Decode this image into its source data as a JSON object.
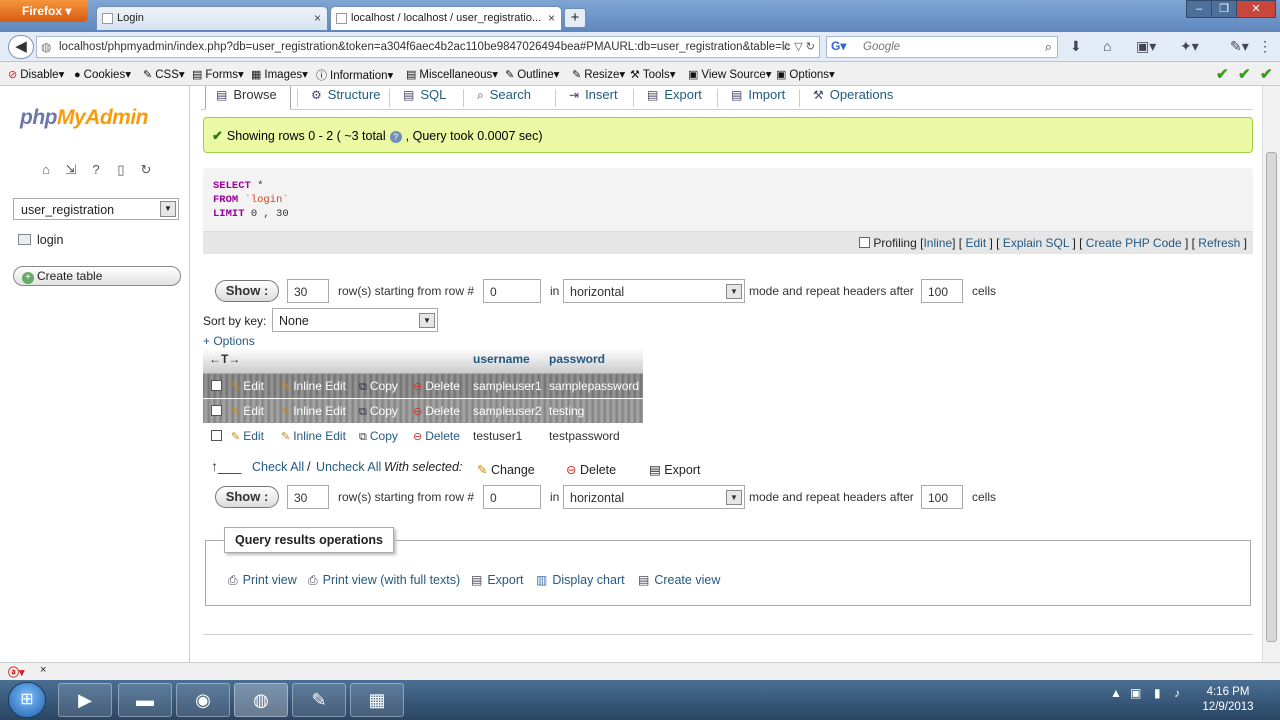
{
  "browser": {
    "firefox_label": "Firefox",
    "tabs": [
      {
        "title": "Login"
      },
      {
        "title": "localhost / localhost / user_registratio..."
      }
    ],
    "url": "localhost/phpmyadmin/index.php?db=user_registration&token=a304f6aec4b2ac110be9847026494bea#PMAURL:db=user_registration&table=lc",
    "search_placeholder": "Google",
    "devbar": [
      "Disable",
      "Cookies",
      "CSS",
      "Forms",
      "Images",
      "Information",
      "Miscellaneous",
      "Outline",
      "Resize",
      "Tools",
      "View Source",
      "Options"
    ]
  },
  "sidebar": {
    "logo_php": "php",
    "logo_myadmin": "MyAdmin",
    "db_selected": "user_registration",
    "tables": [
      "login"
    ],
    "create_table": "Create table"
  },
  "menu": {
    "tabs": [
      "Browse",
      "Structure",
      "SQL",
      "Search",
      "Insert",
      "Export",
      "Import",
      "Operations"
    ],
    "active": "Browse"
  },
  "message": {
    "text": "Showing rows 0 - 2 ( ~3 total",
    "suffix": ", Query took 0.0007 sec)"
  },
  "sql": {
    "line1_kw": "SELECT",
    "line1_rest": " *",
    "line2_kw": "FROM",
    "line2_rest": " `login`",
    "line3_kw": "LIMIT",
    "line3_rest": " 0 , 30",
    "tools": {
      "profiling": "Profiling",
      "inline": "Inline",
      "edit": "Edit",
      "explain": "Explain SQL",
      "create_php": "Create PHP Code",
      "refresh": "Refresh"
    }
  },
  "nav": {
    "show_label": "Show :",
    "rows": "30",
    "rows_text": "row(s) starting from row #",
    "start_row": "0",
    "in_text": "in",
    "mode": "horizontal",
    "mode_text": "mode and repeat headers after",
    "repeat": "100",
    "cells_text": "cells"
  },
  "sort": {
    "label": "Sort by key:",
    "value": "None"
  },
  "options_link": "+ Options",
  "table": {
    "arrows": "←T→",
    "columns": [
      "username",
      "password"
    ],
    "actions": {
      "edit": "Edit",
      "inline_edit": "Inline Edit",
      "copy": "Copy",
      "delete": "Delete"
    },
    "rows": [
      {
        "username": "sampleuser1",
        "password": "samplepassword"
      },
      {
        "username": "sampleuser2",
        "password": "testing"
      },
      {
        "username": "testuser1",
        "password": "testpassword"
      }
    ]
  },
  "with_selected": {
    "check_all": "Check All",
    "sep": " / ",
    "uncheck_all": "Uncheck All",
    "label": "With selected:",
    "change": "Change",
    "delete": "Delete",
    "export": "Export"
  },
  "query_ops": {
    "title": "Query results operations",
    "items": [
      "Print view",
      "Print view (with full texts)",
      "Export",
      "Display chart",
      "Create view"
    ]
  },
  "clock": {
    "time": "4:16 PM",
    "date": "12/9/2013"
  }
}
